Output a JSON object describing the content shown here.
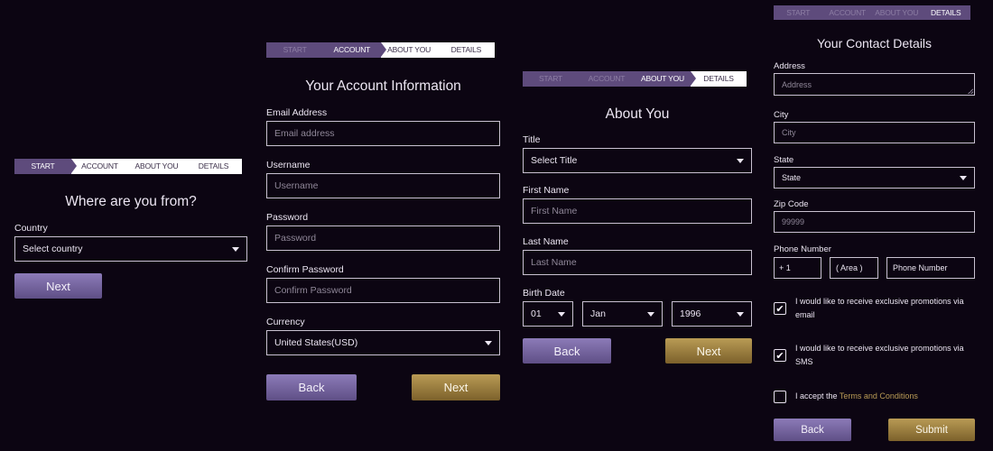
{
  "steps": [
    "START",
    "ACCOUNT",
    "ABOUT YOU",
    "DETAILS"
  ],
  "panel1": {
    "title": "Where are you from?",
    "country_label": "Country",
    "country_value": "Select country",
    "next": "Next"
  },
  "panel2": {
    "title": "Your Account Information",
    "email_label": "Email Address",
    "email_placeholder": "Email address",
    "username_label": "Username",
    "username_placeholder": "Username",
    "password_label": "Password",
    "password_placeholder": "Password",
    "confirm_label": "Confirm Password",
    "confirm_placeholder": "Confirm Password",
    "currency_label": "Currency",
    "currency_value": "United States(USD)",
    "back": "Back",
    "next": "Next"
  },
  "panel3": {
    "title": "About You",
    "title_label": "Title",
    "title_value": "Select Title",
    "first_label": "First Name",
    "first_placeholder": "First Name",
    "last_label": "Last Name",
    "last_placeholder": "Last Name",
    "birth_label": "Birth Date",
    "day": "01",
    "month": "Jan",
    "year": "1996",
    "back": "Back",
    "next": "Next"
  },
  "panel4": {
    "title": "Your Contact Details",
    "address_label": "Address",
    "address_placeholder": "Address",
    "city_label": "City",
    "city_placeholder": "City",
    "state_label": "State",
    "state_value": "State",
    "zip_label": "Zip Code",
    "zip_placeholder": "99999",
    "phone_label": "Phone Number",
    "country_code": "+ 1",
    "area_placeholder": "( Area     )",
    "phone_placeholder": "Phone Number",
    "promo_email": "I would like to receive exclusive promotions via email",
    "promo_email_checked": true,
    "promo_sms": "I would like to receive exclusive promotions via SMS",
    "promo_sms_checked": true,
    "terms_prefix": "I accept the ",
    "terms_link": "Terms and Conditions",
    "terms_checked": false,
    "back": "Back",
    "submit": "Submit"
  },
  "icons": {
    "check": "check-icon",
    "caret": "chevron-down-icon"
  },
  "colors": {
    "background": "#0c0512",
    "purple": "#5e4b7c",
    "gold": "#b99b55"
  }
}
